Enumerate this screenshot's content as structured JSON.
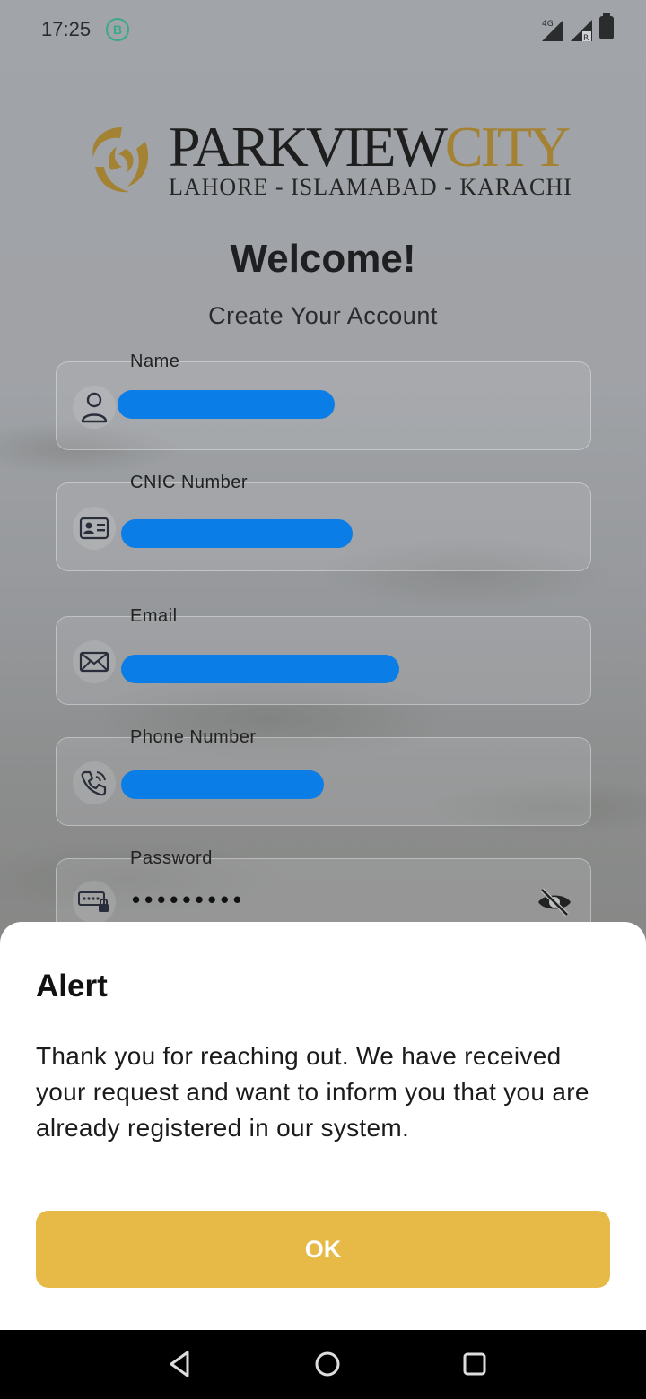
{
  "status_bar": {
    "time": "17:25",
    "notification_badge": "B",
    "network": "4G"
  },
  "brand": {
    "name_main": "PARKVIEW",
    "name_accent": "CITY",
    "tagline": "LAHORE - ISLAMABAD - KARACHI",
    "accent_color": "#a48234"
  },
  "header": {
    "title": "Welcome!",
    "subtitle": "Create Your Account"
  },
  "form": {
    "fields": [
      {
        "label": "Name",
        "icon": "user-icon",
        "value_redacted": true
      },
      {
        "label": "CNIC Number",
        "icon": "id-card-icon",
        "value_redacted": true
      },
      {
        "label": "Email",
        "icon": "mail-icon",
        "value_redacted": true
      },
      {
        "label": "Phone Number",
        "icon": "phone-icon",
        "value_redacted": true
      },
      {
        "label": "Password",
        "icon": "password-icon",
        "value": "•••••••••"
      }
    ],
    "redaction_color": "#0a7de6"
  },
  "dialog": {
    "title": "Alert",
    "message": "Thank you for reaching out. We have received your request and want to inform you that you are already registered in our system.",
    "ok_label": "OK",
    "button_color": "#e7ba48"
  },
  "navbar": {
    "buttons": [
      "back-icon",
      "home-icon",
      "recents-icon"
    ]
  }
}
